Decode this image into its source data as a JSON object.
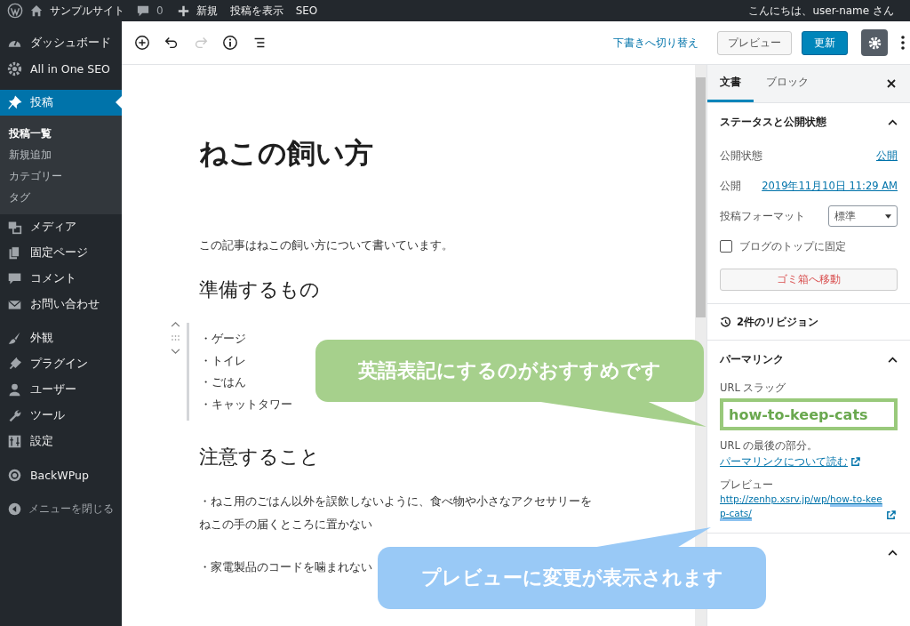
{
  "admin_bar": {
    "site_name": "サンプルサイト",
    "comment_count": "0",
    "new_label": "新規",
    "view_post": "投稿を表示",
    "seo": "SEO",
    "greeting": "こんにちは、user-name さん"
  },
  "sidebar": {
    "groups": [
      {
        "items": [
          {
            "label": "ダッシュボード",
            "selected": false
          },
          {
            "label": "All in One SEO",
            "selected": false
          }
        ]
      },
      {
        "items": [
          {
            "label": "投稿",
            "selected": true,
            "children": [
              {
                "label": "投稿一覧",
                "selected": true
              },
              {
                "label": "新規追加",
                "selected": false
              },
              {
                "label": "カテゴリー",
                "selected": false
              },
              {
                "label": "タグ",
                "selected": false
              }
            ]
          },
          {
            "label": "メディア",
            "selected": false
          },
          {
            "label": "固定ページ",
            "selected": false
          },
          {
            "label": "コメント",
            "selected": false
          },
          {
            "label": "お問い合わせ",
            "selected": false
          }
        ]
      },
      {
        "items": [
          {
            "label": "外観",
            "selected": false
          },
          {
            "label": "プラグイン",
            "selected": false
          },
          {
            "label": "ユーザー",
            "selected": false
          },
          {
            "label": "ツール",
            "selected": false
          },
          {
            "label": "設定",
            "selected": false
          }
        ]
      },
      {
        "items": [
          {
            "label": "BackWPup",
            "selected": false
          }
        ]
      }
    ],
    "collapse_label": "メニューを閉じる"
  },
  "toolbar": {
    "redo_disabled": true,
    "switch_to_draft": "下書きへ切り替え",
    "preview": "プレビュー",
    "update": "更新",
    "settings_active": true
  },
  "post": {
    "title": "ねこの飼い方",
    "blocks": [
      {
        "kind": "paragraph",
        "lines": [
          "この記事はねこの飼い方について書いています。"
        ]
      },
      {
        "kind": "heading",
        "text": "準備するもの"
      },
      {
        "kind": "list",
        "items": [
          "・ゲージ",
          "・トイレ",
          "・ごはん",
          "・キャットタワー"
        ],
        "selected": true
      },
      {
        "kind": "heading",
        "text": "注意すること"
      },
      {
        "kind": "paragraph",
        "lines": [
          "・ねこ用のごはん以外を誤飲しないように、食べ物や小さなアクセサリーを",
          "ねこの手の届くところに置かない"
        ]
      },
      {
        "kind": "paragraph",
        "lines": [
          "・家電製品のコードを噛まれない"
        ]
      }
    ]
  },
  "panel": {
    "tabs": [
      {
        "label": "文書",
        "selected": true
      },
      {
        "label": "ブロック",
        "selected": false
      }
    ],
    "status": {
      "title": "ステータスと公開状態",
      "expanded": true,
      "visibility_label": "公開状態",
      "visibility": "公開",
      "publish_label": "公開",
      "publish_date": "2019年11月10日 11:29 AM",
      "format_label": "投稿フォーマット",
      "format": "標準",
      "sticky": {
        "label": "ブログのトップに固定",
        "checked": false
      },
      "trash": "ゴミ箱へ移動"
    },
    "revisions": "2件のリビジョン",
    "permalink": {
      "title": "パーマリンク",
      "expanded": true,
      "slug_label": "URL スラッグ",
      "slug": "how-to-keep-cats",
      "slug_highlighted": true,
      "help_text": "URL の最後の部分。",
      "help_link": "パーマリンクについて読む",
      "preview_label": "プレビュー",
      "preview_url_prefix": "http://zenhp.xsrv.jp/wp/",
      "preview_url_slug": "how-to-keep-cats/"
    },
    "category": {
      "expanded": true
    }
  },
  "callouts": [
    {
      "text": "英語表記にするのがおすすめです",
      "color": "#a6d08c"
    },
    {
      "text": "プレビューに変更が表示されます",
      "color": "#99c9f6"
    }
  ]
}
